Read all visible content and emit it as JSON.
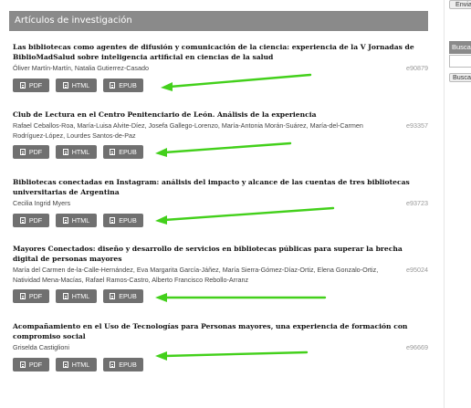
{
  "section": {
    "title": "Artículos de investigación"
  },
  "sidebar": {
    "send_label": "Envia",
    "search_title": "Busca",
    "search_button": "Buscar"
  },
  "articles": [
    {
      "title": "Las bibliotecas como agentes de difusión y comunicación de la ciencia: experiencia de la V Jornadas de BiblioMadSalud sobre inteligencia artificial en ciencias de la salud",
      "authors": "Óliver Martín-Martín, Natalia Gutierrez-Casado",
      "eid": "e90879",
      "galleys": [
        "PDF",
        "HTML",
        "EPUB"
      ]
    },
    {
      "title": "Club de Lectura en el Centro Penitenciario de León. Análisis de la experiencia",
      "authors": "Rafael Ceballos-Roa, María-Luisa Alvite-Díez, Josefa Gallego-Lorenzo, María-Antonia Morán-Suárez, María-del-Carmen Rodríguez-López, Lourdes Santos-de-Paz",
      "eid": "e93357",
      "galleys": [
        "PDF",
        "HTML",
        "EPUB"
      ]
    },
    {
      "title": "Bibliotecas conectadas en Instagram: análisis del impacto y alcance de las cuentas de tres bibliotecas universitarias de Argentina",
      "authors": "Cecilia Ingrid Myers",
      "eid": "e93723",
      "galleys": [
        "PDF",
        "HTML",
        "EPUB"
      ]
    },
    {
      "title": "Mayores Conectados: diseño y desarrollo de servicios en bibliotecas públicas para superar la brecha digital de personas mayores",
      "authors": "María del Carmen de-la-Calle-Hernández, Eva Margarita García-Jáñez, María Sierra-Gómez-Díaz-Ortiz, Elena Gonzalo-Ortiz, Natividad Mena-Macías, Rafael Ramos-Castro, Alberto Francisco Rebollo-Arranz",
      "eid": "e95024",
      "galleys": [
        "PDF",
        "HTML",
        "EPUB"
      ]
    },
    {
      "title": "Acompañamiento en el Uso de Tecnologías para Personas mayores, una experiencia de formación con compromiso social",
      "authors": "Griselda Castiglioni",
      "eid": "e96669",
      "galleys": [
        "PDF",
        "HTML",
        "EPUB"
      ]
    }
  ],
  "colors": {
    "header_bg": "#8a8a8a",
    "galley_bg": "#707070",
    "annotation_arrow": "#43d01b"
  }
}
